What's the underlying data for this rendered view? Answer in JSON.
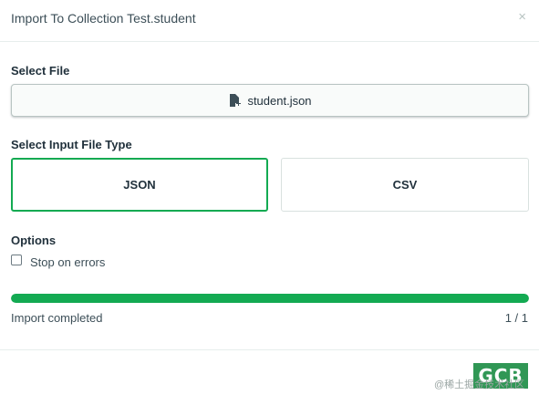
{
  "dialog": {
    "title": "Import To Collection Test.student",
    "close_icon": "×"
  },
  "file": {
    "label": "Select File",
    "filename": "student.json",
    "icon": "file-icon"
  },
  "file_type": {
    "label": "Select Input File Type",
    "options": [
      {
        "label": "JSON",
        "selected": true
      },
      {
        "label": "CSV",
        "selected": false
      }
    ]
  },
  "options": {
    "title": "Options",
    "stop_on_errors": {
      "label": "Stop on errors",
      "checked": false
    }
  },
  "progress": {
    "fraction": 1.0,
    "status": "Import completed",
    "count": "1 / 1"
  },
  "watermark": {
    "text": "@稀土掘金技术社区",
    "logo": "GCB"
  },
  "colors": {
    "accent": "#13aa52",
    "border": "#b8c4c2",
    "text": "#3d4f58"
  }
}
